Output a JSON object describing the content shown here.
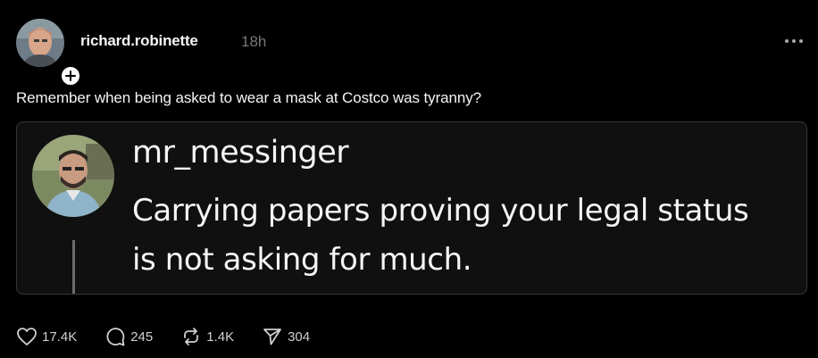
{
  "post": {
    "username": "richard.robinette",
    "timestamp": "18h",
    "text": "Remember when being asked to wear a mask at Costco was tyranny?",
    "more_icon": "more-horizontal-icon",
    "follow_icon": "plus-icon"
  },
  "quote": {
    "username": "mr_messinger",
    "text": "Carrying papers proving your legal status is not asking for much."
  },
  "actions": {
    "like_count": "17.4K",
    "reply_count": "245",
    "repost_count": "1.4K",
    "share_count": "304"
  },
  "colors": {
    "background": "#000000",
    "text": "#f3f5f7",
    "muted": "#777777",
    "card_border": "#333638"
  }
}
